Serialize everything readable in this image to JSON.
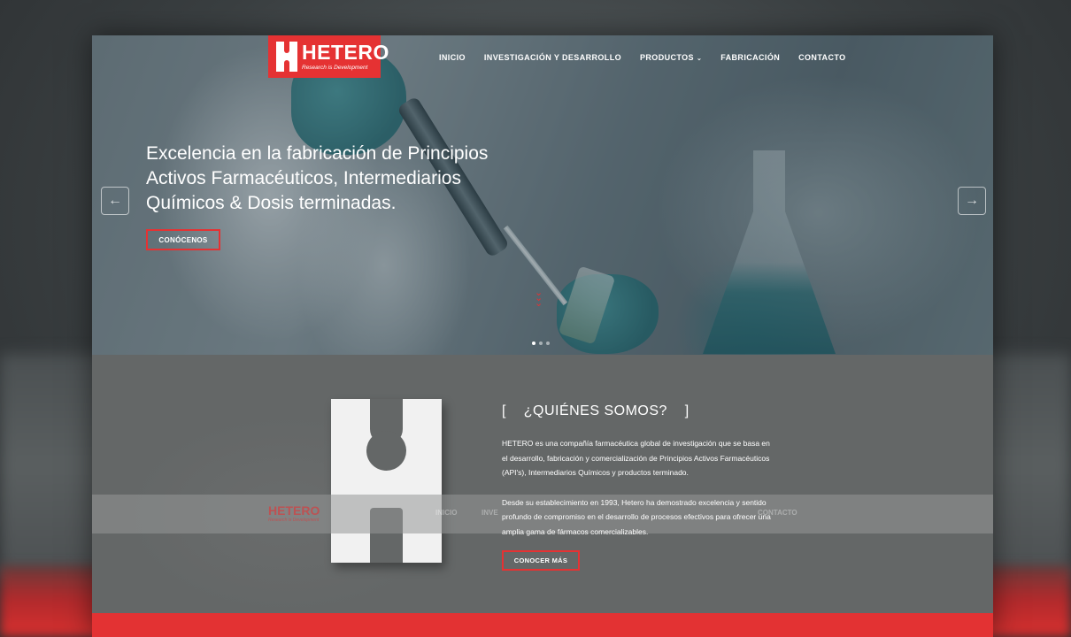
{
  "brand": {
    "name": "HETERO",
    "tagline": "Research is Development",
    "accent": "#e53233"
  },
  "nav": {
    "items": [
      {
        "label": "INICIO"
      },
      {
        "label": "INVESTIGACIÓN Y DESARROLLO"
      },
      {
        "label": "PRODUCTOS",
        "dropdown": true
      },
      {
        "label": "FABRICACIÓN"
      },
      {
        "label": "CONTACTO"
      }
    ],
    "caret": "⌄"
  },
  "hero": {
    "headline": "Excelencia en la fabricación de Principios Activos Farmacéuticos, Intermediarios Químicos & Dosis terminadas.",
    "cta_label": "CONÓCENOS",
    "prev_icon": "←",
    "next_icon": "→",
    "scroll_icon": "⌄⌄⌄",
    "slides": 3,
    "active_slide": 1
  },
  "about": {
    "title": "[    ¿QUIÉNES SOMOS?    ]",
    "paragraph1": "HETERO es una compañía farmacéutica global de investigación que se basa en el desarrollo, fabricación y comercialización de Principios Activos Farmacéuticos (API's), Intermediarios Químicos y productos terminado.",
    "paragraph2": "Desde su establecimiento en 1993, Hetero ha demostrado excelencia y sentido profundo de compromiso en el desarrollo de procesos efectivos para ofrecer una amplia gama de fármacos comercializables.",
    "button_label": "CONOCER MÁS"
  },
  "ghost_nav": {
    "logo": "HETERO",
    "tagline": "Research is Development",
    "items": [
      "INICIO",
      "INVE",
      "CONTACTO"
    ]
  }
}
